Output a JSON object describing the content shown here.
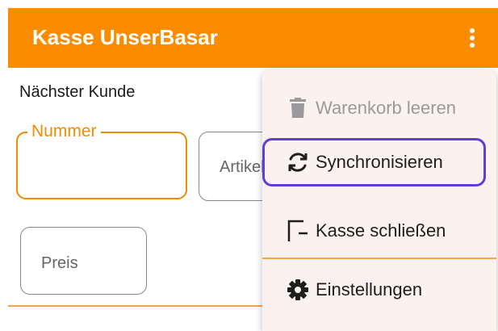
{
  "appbar": {
    "title": "Kasse UnserBasar",
    "color": "#fb8c00",
    "overflow_icon": "more-vert-icon"
  },
  "content": {
    "next_customer_label": "Nächster Kunde",
    "fields": {
      "nummer_label": "Nummer",
      "artikel_label": "Artikel",
      "preis_label": "Preis"
    },
    "accent_color": "#f08c00"
  },
  "menu": {
    "items": [
      {
        "label": "Warenkorb leeren",
        "icon": "trash-icon",
        "enabled": false
      },
      {
        "label": "Synchronisieren",
        "icon": "sync-icon",
        "enabled": true,
        "focused": true
      },
      {
        "label": "Kasse schließen",
        "icon": "close-register-icon",
        "enabled": true
      },
      {
        "label": "Einstellungen",
        "icon": "gear-icon",
        "enabled": true
      }
    ],
    "focus_color": "#5b3fd6"
  }
}
